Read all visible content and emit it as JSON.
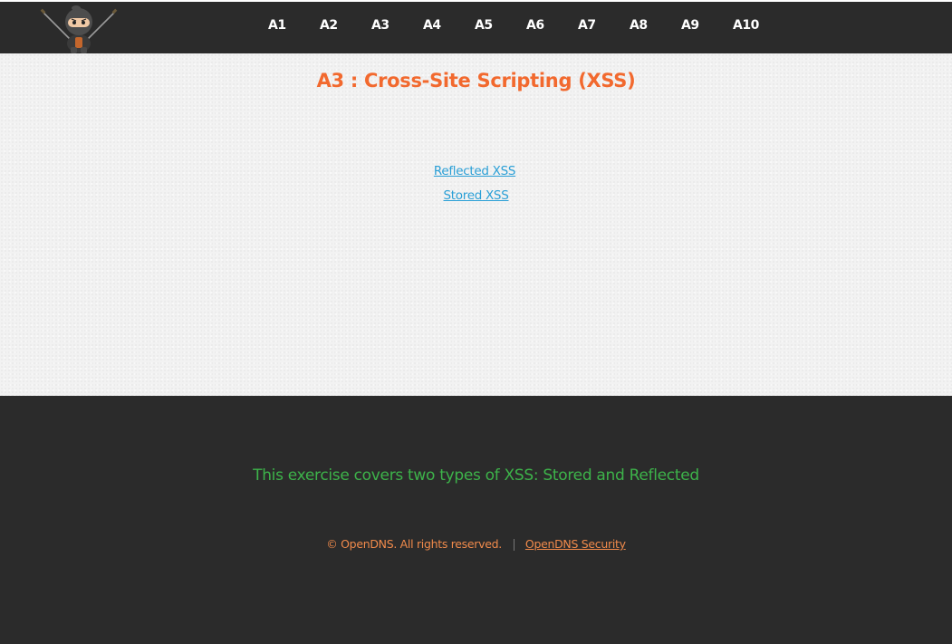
{
  "nav": {
    "logo_icon": "ninja-mascot-icon",
    "items": [
      {
        "label": "A1"
      },
      {
        "label": "A2"
      },
      {
        "label": "A3"
      },
      {
        "label": "A4"
      },
      {
        "label": "A5"
      },
      {
        "label": "A6"
      },
      {
        "label": "A7"
      },
      {
        "label": "A8"
      },
      {
        "label": "A9"
      },
      {
        "label": "A10"
      }
    ]
  },
  "main": {
    "title": "A3 : Cross-Site Scripting (XSS)",
    "links": [
      {
        "label": "Reflected XSS"
      },
      {
        "label": "Stored XSS"
      }
    ]
  },
  "footer": {
    "description": "This exercise covers two types of XSS: Stored and Reflected",
    "copyright": "© OpenDNS. All rights reserved.",
    "link_label": "OpenDNS Security"
  },
  "colors": {
    "nav_bg": "#2b2b2b",
    "title": "#f2692e",
    "link": "#2a9fd6",
    "footer_desc": "#3db34a",
    "footer_text": "#f08a4b"
  }
}
